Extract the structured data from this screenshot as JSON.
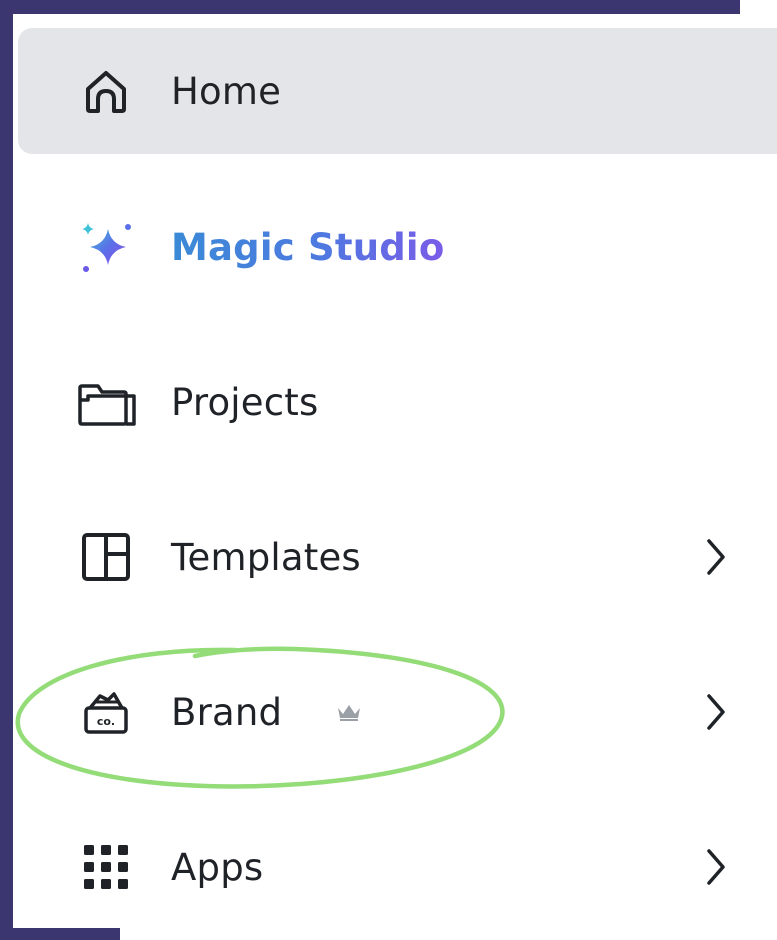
{
  "nav": {
    "items": [
      {
        "id": "home",
        "label": "Home",
        "icon": "home-icon",
        "active": true,
        "has_chevron": false
      },
      {
        "id": "magic-studio",
        "label": "Magic Studio",
        "icon": "sparkle-icon",
        "active": false,
        "has_chevron": false
      },
      {
        "id": "projects",
        "label": "Projects",
        "icon": "folder-icon",
        "active": false,
        "has_chevron": false
      },
      {
        "id": "templates",
        "label": "Templates",
        "icon": "templates-icon",
        "active": false,
        "has_chevron": true
      },
      {
        "id": "brand",
        "label": "Brand",
        "icon": "brand-kit-icon",
        "active": false,
        "has_chevron": true,
        "badge_icon": "crown-icon"
      },
      {
        "id": "apps",
        "label": "Apps",
        "icon": "apps-grid-icon",
        "active": false,
        "has_chevron": true
      }
    ]
  },
  "colors": {
    "frame": "#3b3670",
    "active_bg": "#e4e5e8",
    "text": "#1f2328",
    "magic_gradient_start": "#3a8ad6",
    "magic_gradient_end": "#7a5ce8",
    "highlight_stroke": "#93dc78"
  }
}
